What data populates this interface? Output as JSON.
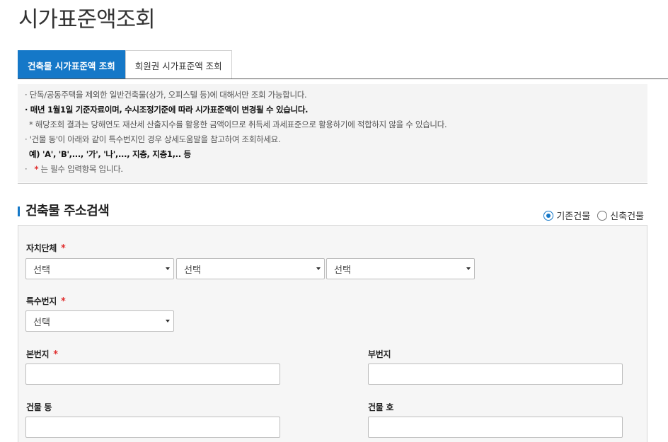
{
  "page": {
    "title": "시가표준액조회"
  },
  "tabs": [
    {
      "label": "건축물 시가표준액 조회",
      "active": true
    },
    {
      "label": "회원권 시가표준액 조회",
      "active": false
    }
  ],
  "notice": {
    "lines": [
      "· 단독/공동주택을 제외한 일반건축물(상가, 오피스텔 등)에 대해서만 조회 가능합니다.",
      "· 매년 1월1일 기준자료이며, 수시조정기준에 따라 시가표준액이 변경될 수 있습니다.",
      "* 해당조회 결과는 당해연도 재산세 산출지수를 활용한 금액이므로 취득세 과세표준으로 활용하기에 적합하지 않을 수 있습니다.",
      "· '건물 동'이 아래와 같이 특수번지인 경우 상세도움말을 참고하여 조회하세요.",
      "예) 'A', 'B',..., '가', '나',..., 지층, 지층1,.. 등"
    ],
    "required_prefix": "· ",
    "required_star": "*",
    "required_text": " 는 필수 입력항목 입니다."
  },
  "section": {
    "title": "건축물 주소검색"
  },
  "radios": [
    {
      "label": "기존건물",
      "checked": true
    },
    {
      "label": "신축건물",
      "checked": false
    }
  ],
  "form": {
    "required_star": "*",
    "municipality": {
      "label": "자치단체",
      "selects": [
        "선택",
        "선택",
        "선택"
      ]
    },
    "special_lot": {
      "label": "특수번지",
      "select": "선택"
    },
    "main_lot": {
      "label": "본번지",
      "value": ""
    },
    "sub_lot": {
      "label": "부번지",
      "value": ""
    },
    "building_dong": {
      "label": "건물 동",
      "value": ""
    },
    "building_ho": {
      "label": "건물 호",
      "value": ""
    }
  },
  "colors": {
    "accent": "#1578c8",
    "required": "#e03030"
  }
}
